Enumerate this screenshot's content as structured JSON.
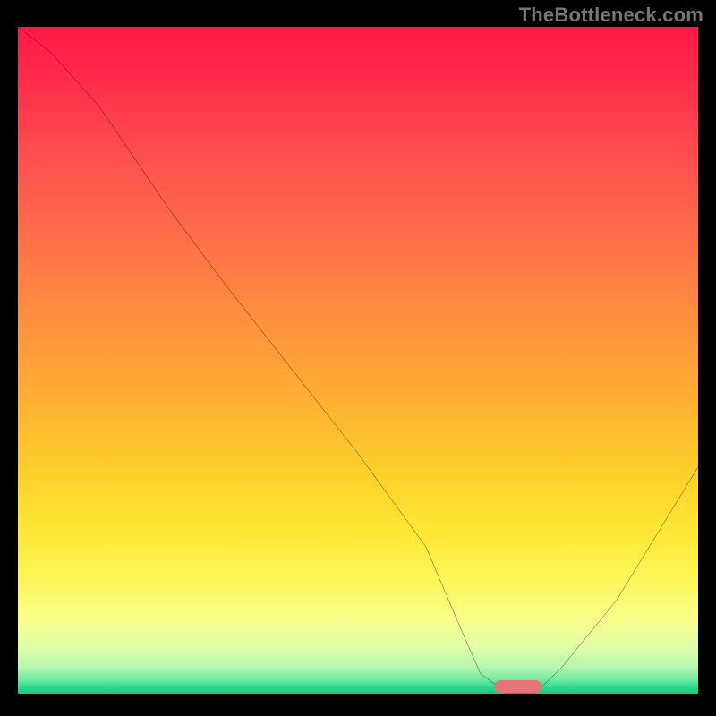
{
  "watermark": "TheBottleneck.com",
  "chart_data": {
    "type": "line",
    "title": "",
    "xlabel": "",
    "ylabel": "",
    "xlim": [
      0,
      100
    ],
    "ylim": [
      0,
      100
    ],
    "grid": false,
    "legend": false,
    "background_gradient": {
      "top_color": "#ff1846",
      "mid_color": "#ffd02a",
      "bottom_color": "#15c97f",
      "description": "vertical red-orange-yellow-green gradient (red = high bottleneck, green = optimal)"
    },
    "series": [
      {
        "name": "bottleneck-curve",
        "color": "#000000",
        "x": [
          0,
          5,
          12,
          20,
          22,
          30,
          40,
          50,
          60,
          65,
          68,
          72,
          76,
          80,
          88,
          100
        ],
        "y": [
          100,
          96,
          88,
          76,
          73,
          62,
          49,
          36,
          22,
          10,
          3,
          0,
          0,
          4,
          14,
          34
        ]
      }
    ],
    "marker": {
      "name": "optimal-range",
      "color": "#e9737a",
      "x_start": 70,
      "x_end": 77,
      "y": 0,
      "description": "highlighted optimal zone at minimum of curve"
    },
    "source": "TheBottleneck.com"
  }
}
